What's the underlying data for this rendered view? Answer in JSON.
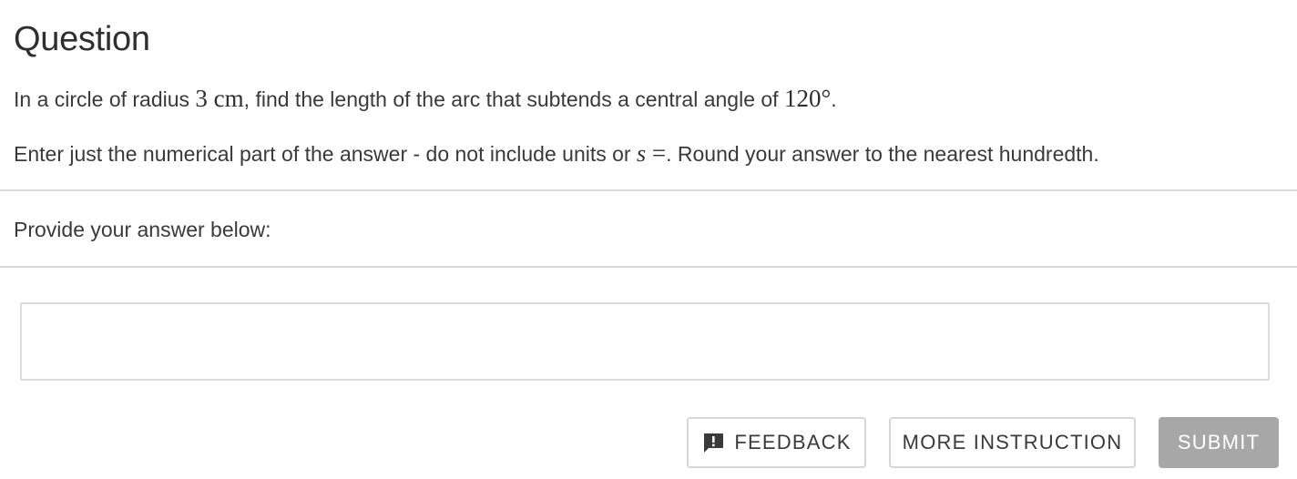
{
  "question": {
    "heading": "Question",
    "line1": {
      "before": "In a circle of radius ",
      "radius": "3 cm",
      "middle": ", find the length of the arc that subtends a central angle of ",
      "angle": "120°",
      "after": "."
    },
    "line2": {
      "before": "Enter just the numerical part of the answer - do not include units or ",
      "var": "s",
      "eq": " =",
      "after": ". Round your answer to the nearest hundredth."
    }
  },
  "answer": {
    "prompt": "Provide your answer below:",
    "value": "",
    "placeholder": ""
  },
  "buttons": {
    "feedback": "FEEDBACK",
    "feedback_icon": "feedback-icon",
    "more_instruction": "MORE INSTRUCTION",
    "submit": "SUBMIT"
  },
  "colors": {
    "submit_disabled_bg": "#a7a7a7",
    "divider": "#d9d9d9",
    "text": "#3a3a3a"
  }
}
